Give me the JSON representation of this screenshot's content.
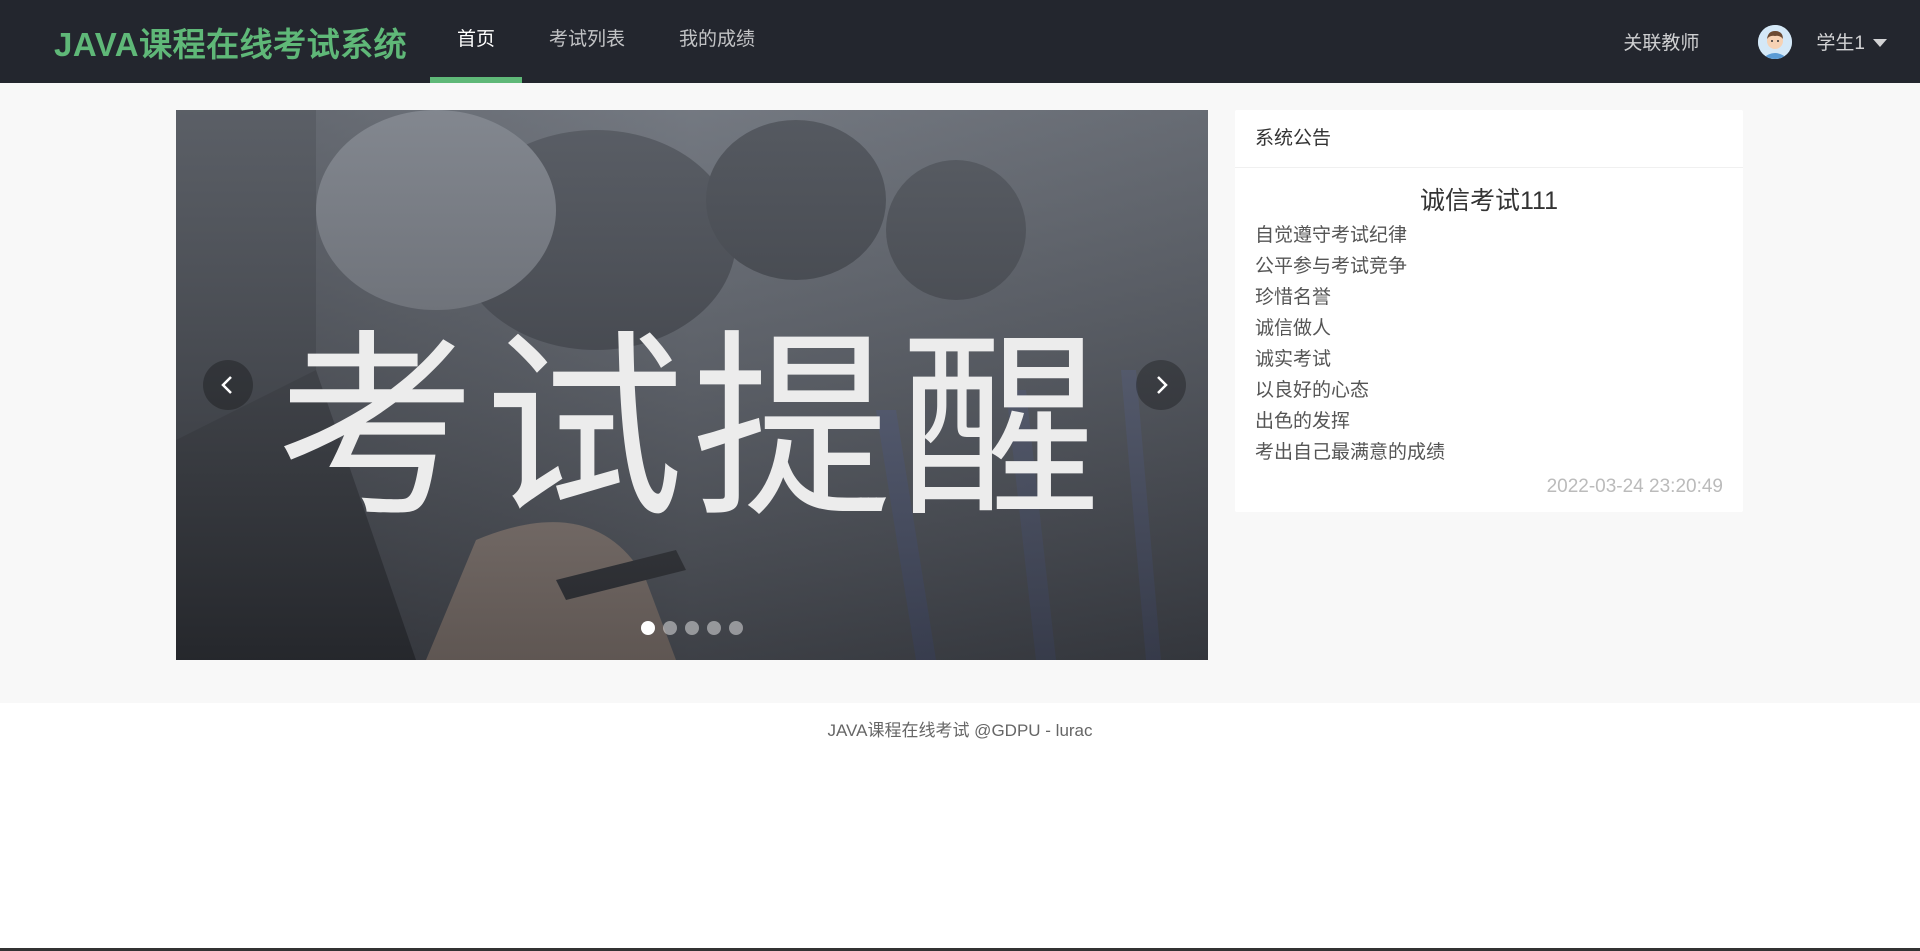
{
  "header": {
    "brand": "JAVA课程在线考试系统",
    "nav": [
      {
        "label": "首页",
        "active": true
      },
      {
        "label": "考试列表",
        "active": false
      },
      {
        "label": "我的成绩",
        "active": false
      }
    ],
    "related_teacher": "关联教师",
    "username": "学生1",
    "accent_color": "#5fb878",
    "bar_color": "#23262e"
  },
  "carousel": {
    "slide_text": "考试提醒",
    "prev_icon": "chevron-left-icon",
    "next_icon": "chevron-right-icon",
    "slide_count": 5,
    "active_index": 0
  },
  "notice": {
    "header": "系统公告",
    "title": "诚信考试111",
    "lines": [
      "自觉遵守考试纪律",
      "公平参与考试竞争",
      "珍惜名誉",
      "诚信做人",
      "诚实考试",
      "以良好的心态",
      "出色的发挥",
      "考出自己最满意的成绩"
    ],
    "time": "2022-03-24 23:20:49"
  },
  "footer": {
    "text": "JAVA课程在线考试 @GDPU - lurac"
  }
}
